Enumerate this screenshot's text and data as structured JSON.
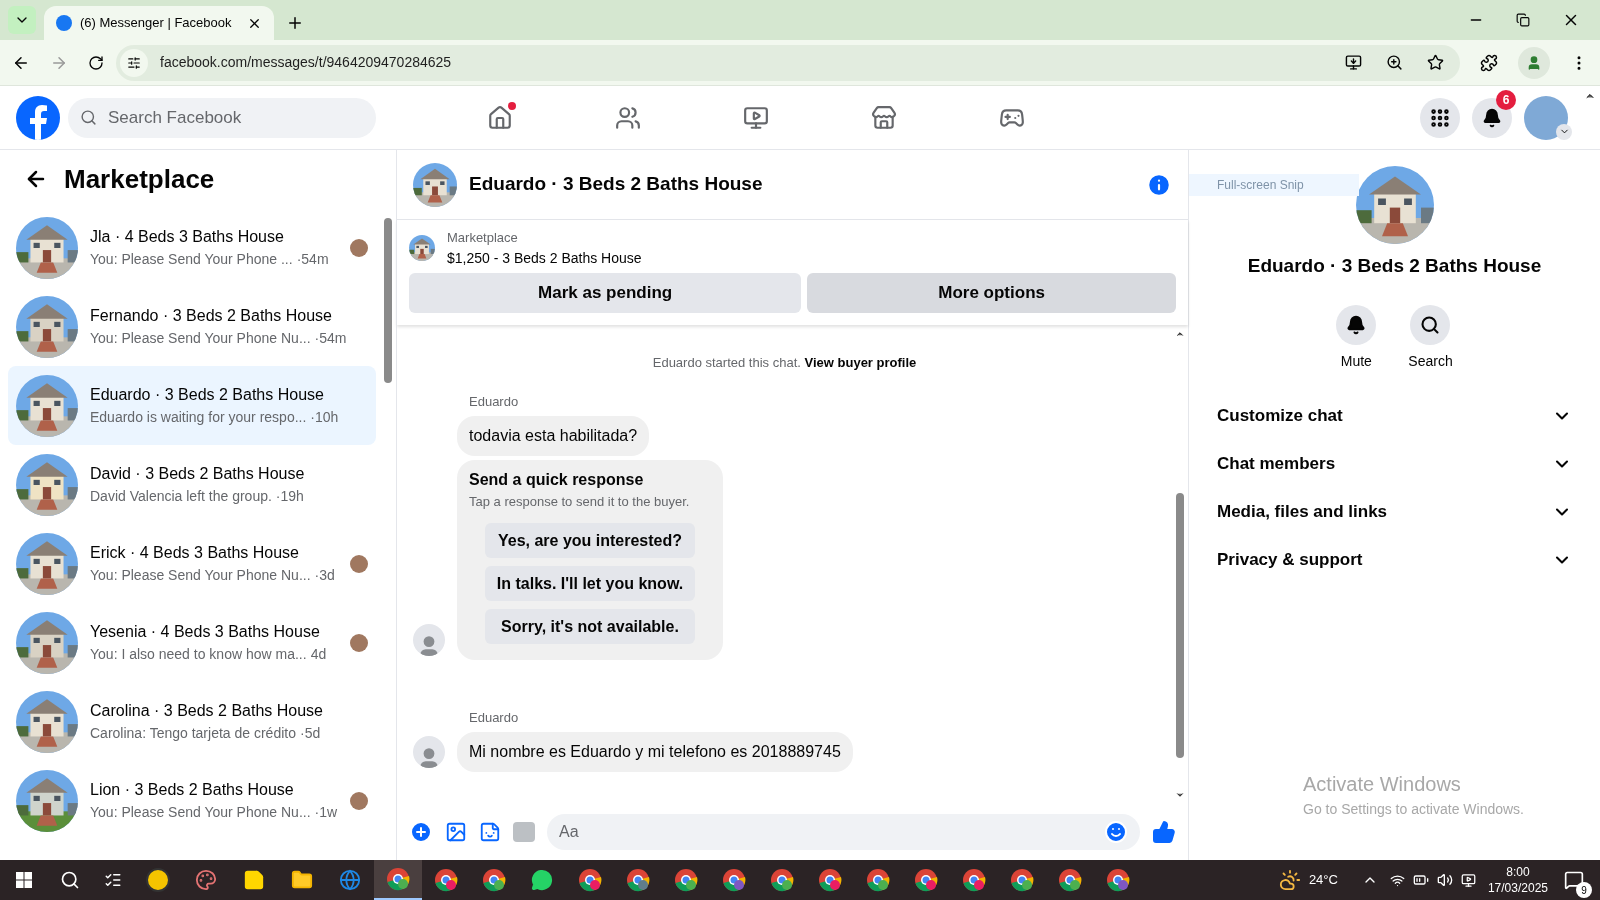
{
  "browser": {
    "tab": {
      "title": "(6) Messenger | Facebook",
      "selected": true
    },
    "url": "facebook.com/messages/t/9464209470284625"
  },
  "header": {
    "search": {
      "placeholder": "Search Facebook"
    },
    "nav": [
      {
        "kind": "home",
        "selected": false,
        "dot": true
      },
      {
        "kind": "friends",
        "selected": false,
        "dot": false
      },
      {
        "kind": "video",
        "selected": false,
        "dot": false
      },
      {
        "kind": "marketplace",
        "selected": false,
        "dot": false
      },
      {
        "kind": "gaming",
        "selected": false,
        "dot": false
      }
    ],
    "notifications_badge": "6"
  },
  "sidebar": {
    "title": "Marketplace",
    "conversations": [
      {
        "name": "Jla · 4 Beds 3 Baths House",
        "preview": "You: Please Send Your Phone ...",
        "time": "·54m",
        "selected": false,
        "seen": true
      },
      {
        "name": "Fernando · 3 Beds 2 Baths House",
        "preview": "You: Please Send Your Phone Nu...",
        "time": "·54m",
        "selected": false,
        "seen": false
      },
      {
        "name": "Eduardo · 3 Beds 2 Baths House",
        "preview": "Eduardo is waiting for your respo...",
        "time": "·10h",
        "selected": true,
        "seen": false
      },
      {
        "name": "David · 3 Beds 2 Baths House",
        "preview": "David Valencia left the group.",
        "time": "·19h",
        "selected": false,
        "seen": false
      },
      {
        "name": "Erick · 4 Beds 3 Baths House",
        "preview": "You: Please Send Your Phone Nu...",
        "time": "·3d",
        "selected": false,
        "seen": true
      },
      {
        "name": "Yesenia · 4 Beds 3 Baths House",
        "preview": "You: I also need to know how ma...",
        "time": "4d",
        "selected": false,
        "seen": true
      },
      {
        "name": "Carolina · 3 Beds 2 Baths House",
        "preview": "Carolina: Tengo tarjeta de crédito",
        "time": "·5d",
        "selected": false,
        "seen": false
      },
      {
        "name": "Lion · 3 Beds 2 Baths House",
        "preview": "You: Please Send Your Phone Nu...",
        "time": "·1w",
        "selected": false,
        "seen": true
      }
    ]
  },
  "chat": {
    "title": "Eduardo · 3 Beds 2 Baths House",
    "listing": {
      "label": "Marketplace",
      "item": "$1,250 - 3 Beds 2 Baths House"
    },
    "buttons": [
      "Mark as pending",
      "More options"
    ],
    "note": {
      "text": "Eduardo started this chat.",
      "link": "View buyer profile"
    },
    "groups": [
      {
        "sender": "Eduardo",
        "items": [
          {
            "kind": "text",
            "text": "todavia esta habilitada?"
          },
          {
            "kind": "quick_replies",
            "title": "Send a quick response",
            "subtitle": "Tap a response to send it to the buyer.",
            "options": [
              "Yes, are you interested?",
              "In talks. I'll let you know.",
              "Sorry, it's not available."
            ]
          }
        ]
      },
      {
        "sender": "Eduardo",
        "items": [
          {
            "kind": "text",
            "text": "Mi nombre es Eduardo y mi telefono es 2018889745"
          }
        ]
      }
    ],
    "composer": {
      "placeholder": "Aa"
    }
  },
  "details": {
    "name": "Eduardo · 3 Beds 2 Baths House",
    "actions": [
      {
        "kind": "bell",
        "label": "Mute"
      },
      {
        "kind": "search",
        "label": "Search"
      }
    ],
    "sections": [
      {
        "label": "Customize chat",
        "expanded": false
      },
      {
        "label": "Chat members",
        "expanded": false
      },
      {
        "label": "Media, files and links",
        "expanded": false
      },
      {
        "label": "Privacy & support",
        "expanded": false
      }
    ]
  },
  "overlays": {
    "snip": "Full-screen Snip",
    "activation_title": "Activate Windows",
    "activation_text": "Go to Settings to activate Windows."
  },
  "taskbar": {
    "apps": [
      {
        "kind": "widget",
        "selected": false
      },
      {
        "kind": "paint",
        "selected": false
      },
      {
        "kind": "notes",
        "selected": false
      },
      {
        "kind": "files",
        "selected": false
      },
      {
        "kind": "edge",
        "selected": false
      },
      {
        "kind": "chrome",
        "selected": true,
        "color": "#4caf50"
      },
      {
        "kind": "chrome",
        "selected": false,
        "color": "#e91e63"
      },
      {
        "kind": "chrome",
        "selected": false,
        "color": "#4caf50"
      },
      {
        "kind": "whatsapp",
        "selected": false
      },
      {
        "kind": "chrome",
        "selected": false,
        "color": "#e91e63"
      },
      {
        "kind": "chrome",
        "selected": false,
        "color": "#607d8b"
      },
      {
        "kind": "chrome",
        "selected": false,
        "color": "#4caf50"
      },
      {
        "kind": "chrome",
        "selected": false,
        "color": "#7e57c2"
      },
      {
        "kind": "chrome",
        "selected": false,
        "color": "#4caf50"
      },
      {
        "kind": "chrome",
        "selected": false,
        "color": "#e91e63"
      },
      {
        "kind": "chrome",
        "selected": false,
        "color": "#4caf50"
      },
      {
        "kind": "chrome",
        "selected": false,
        "color": "#e91e63"
      },
      {
        "kind": "chrome",
        "selected": false,
        "color": "#e91e63"
      },
      {
        "kind": "chrome",
        "selected": false,
        "color": "#4caf50"
      },
      {
        "kind": "chrome",
        "selected": false,
        "color": "#4caf50"
      },
      {
        "kind": "chrome",
        "selected": false,
        "color": "#7e57c2"
      }
    ],
    "temperature": "24°C",
    "time": "8:00",
    "date": "17/03/2025",
    "notifications": "9"
  }
}
